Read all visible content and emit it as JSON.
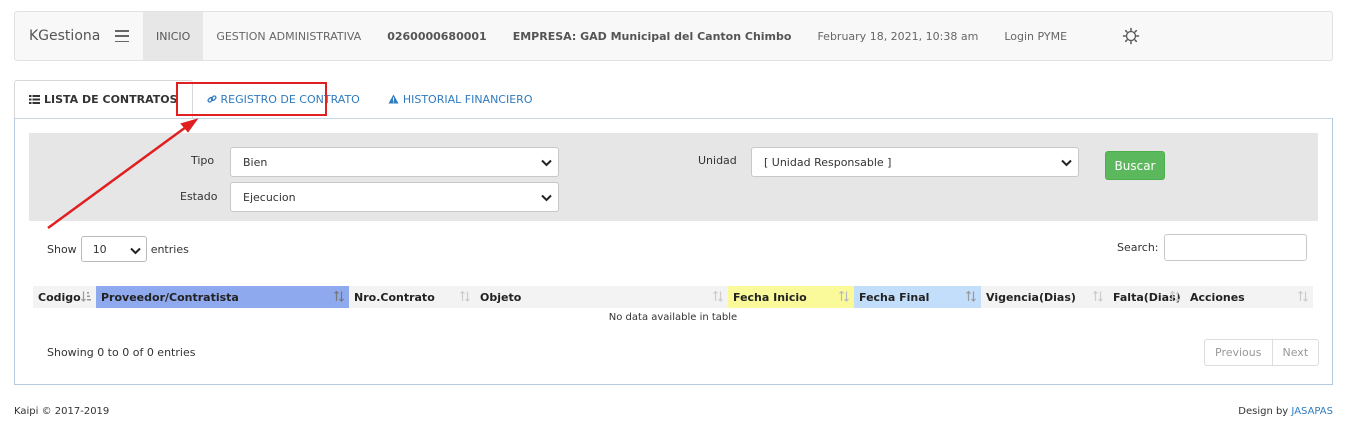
{
  "navbar": {
    "brand": "KGestiona",
    "items": [
      "INICIO",
      "GESTION ADMINISTRATIVA",
      "0260000680001",
      "EMPRESA: GAD Municipal del Canton Chimbo",
      "February 18, 2021, 10:38 am",
      "Login PYME"
    ]
  },
  "tabs": [
    "LISTA DE CONTRATOS",
    "REGISTRO DE CONTRATO",
    "HISTORIAL FINANCIERO"
  ],
  "filters": {
    "tipo_label": "Tipo",
    "tipo_value": "Bien",
    "estado_label": "Estado",
    "estado_value": "Ejecucion",
    "unidad_label": "Unidad",
    "unidad_value": "[ Unidad Responsable ]",
    "buscar_label": "Buscar"
  },
  "table": {
    "show_label": "Show",
    "entries_label": "entries",
    "length_value": "10",
    "search_label": "Search:",
    "columns": [
      "Codigo",
      "Proveedor/Contratista",
      "Nro.Contrato",
      "Objeto",
      "Fecha Inicio",
      "Fecha Final",
      "Vigencia(Dias)",
      "Falta(Dias)",
      "Acciones"
    ],
    "empty_message": "No data available in table",
    "info": "Showing 0 to 0 of 0 entries",
    "previous_label": "Previous",
    "next_label": "Next"
  },
  "footer": {
    "copyright": "Kaipi © 2017-2019",
    "design_prefix": "Design by",
    "design_link": "JASAPAS"
  },
  "colors": {
    "highlight": "#e02020",
    "col_proveedor": "#8fa9ef",
    "col_fecha_inicio": "#fafa9a",
    "col_fecha_final": "#c3defa",
    "buscar": "#5cb85c"
  }
}
